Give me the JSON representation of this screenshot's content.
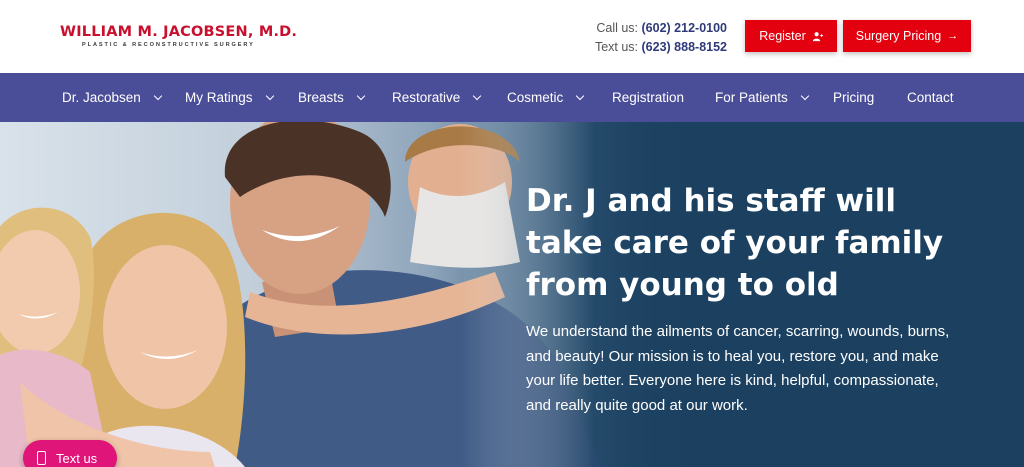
{
  "header": {
    "logo_name": "WILLIAM M. JACOBSEN, M.D.",
    "logo_tagline": "PLASTIC & RECONSTRUCTIVE SURGERY",
    "call_label": "Call us:",
    "call_number": "(602) 212-0100",
    "text_label": "Text us:",
    "text_number": "(623) 888-8152",
    "register_label": "Register",
    "pricing_label": "Surgery Pricing",
    "accent_color": "#e3000f"
  },
  "nav": {
    "background": "#4a4d97",
    "items": [
      {
        "label": "Dr. Jacobsen",
        "dropdown": true
      },
      {
        "label": "My Ratings",
        "dropdown": true
      },
      {
        "label": "Breasts",
        "dropdown": true
      },
      {
        "label": "Restorative",
        "dropdown": true
      },
      {
        "label": "Cosmetic",
        "dropdown": true
      },
      {
        "label": "Registration",
        "dropdown": false
      },
      {
        "label": "For Patients",
        "dropdown": true
      },
      {
        "label": "Pricing",
        "dropdown": false
      },
      {
        "label": "Contact",
        "dropdown": false
      }
    ]
  },
  "hero": {
    "title_line1": "Dr. J and his staff will",
    "title_line2": "take care of your family",
    "title_line3": "from young to old",
    "body": "We understand the ailments of cancer, scarring, wounds, burns, and beauty! Our mission is to heal you, restore you, and make your life better. Everyone here is kind, helpful, compassionate, and really quite good at our work."
  },
  "text_us_widget": {
    "label": "Text us",
    "color": "#e0157a"
  }
}
